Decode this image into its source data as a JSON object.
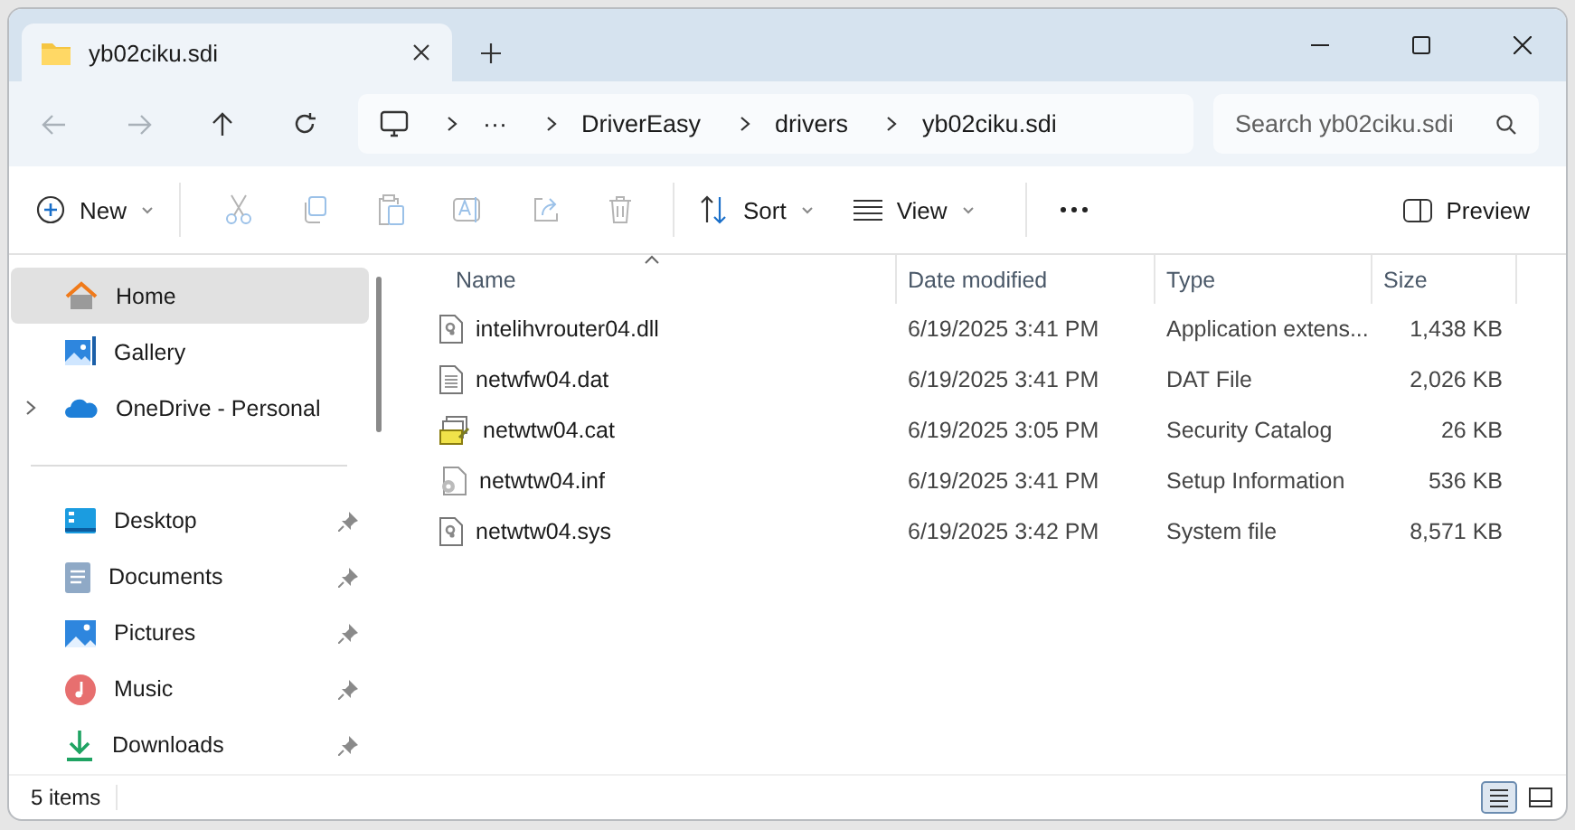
{
  "window": {
    "tab_title": "yb02ciku.sdi"
  },
  "nav": [
    {
      "kind": "back",
      "disabled": true
    },
    {
      "kind": "forward",
      "disabled": true
    },
    {
      "kind": "up",
      "disabled": false
    },
    {
      "kind": "refresh",
      "disabled": false
    }
  ],
  "breadcrumbs": [
    "···",
    "DriverEasy",
    "drivers",
    "yb02ciku.sdi"
  ],
  "search": {
    "placeholder": "Search yb02ciku.sdi"
  },
  "commands": [
    {
      "kind": "new",
      "label": "New",
      "disabled": false
    },
    {
      "kind": "cut",
      "disabled": true
    },
    {
      "kind": "copy",
      "disabled": true
    },
    {
      "kind": "paste",
      "disabled": true
    },
    {
      "kind": "rename",
      "disabled": true
    },
    {
      "kind": "share",
      "disabled": true
    },
    {
      "kind": "delete",
      "disabled": true
    },
    {
      "kind": "sort",
      "label": "Sort",
      "disabled": false
    },
    {
      "kind": "view",
      "label": "View",
      "disabled": false
    },
    {
      "kind": "more",
      "disabled": false
    }
  ],
  "preview": {
    "label": "Preview"
  },
  "sidebar": {
    "top": [
      {
        "kind": "home",
        "label": "Home",
        "selected": true
      },
      {
        "kind": "gallery",
        "label": "Gallery",
        "selected": false
      },
      {
        "kind": "cloud",
        "label": "OneDrive - Personal",
        "selected": false,
        "expanded": false
      }
    ],
    "pinned": [
      {
        "kind": "desktop",
        "label": "Desktop",
        "selected": false,
        "pinned": true
      },
      {
        "kind": "documents",
        "label": "Documents",
        "selected": false,
        "pinned": true
      },
      {
        "kind": "pictures",
        "label": "Pictures",
        "selected": false,
        "pinned": true
      },
      {
        "kind": "music",
        "label": "Music",
        "selected": false,
        "pinned": true
      },
      {
        "kind": "downloads",
        "label": "Downloads",
        "selected": false,
        "pinned": true
      }
    ]
  },
  "table": {
    "columns": [
      {
        "label": "Name",
        "sorted": true
      },
      {
        "label": "Date modified",
        "sorted": false
      },
      {
        "label": "Type",
        "sorted": false
      },
      {
        "label": "Size",
        "sorted": false
      }
    ],
    "rows": [
      {
        "kind": "system",
        "name": "intelihvrouter04.dll",
        "date": "6/19/2025 3:41 PM",
        "type": "Application extens...",
        "size": "1,438 KB"
      },
      {
        "kind": "text",
        "name": "netwfw04.dat",
        "date": "6/19/2025 3:41 PM",
        "type": "DAT File",
        "size": "2,026 KB"
      },
      {
        "kind": "catalog",
        "name": "netwtw04.cat",
        "date": "6/19/2025 3:05 PM",
        "type": "Security Catalog",
        "size": "26 KB"
      },
      {
        "kind": "setup",
        "name": "netwtw04.inf",
        "date": "6/19/2025 3:41 PM",
        "type": "Setup Information",
        "size": "536 KB"
      },
      {
        "kind": "system",
        "name": "netwtw04.sys",
        "date": "6/19/2025 3:42 PM",
        "type": "System file",
        "size": "8,571 KB"
      }
    ]
  },
  "status_bar": {
    "count": "5 items"
  },
  "views": [
    {
      "kind": "details",
      "selected": true
    },
    {
      "kind": "tiles",
      "selected": false
    }
  ]
}
